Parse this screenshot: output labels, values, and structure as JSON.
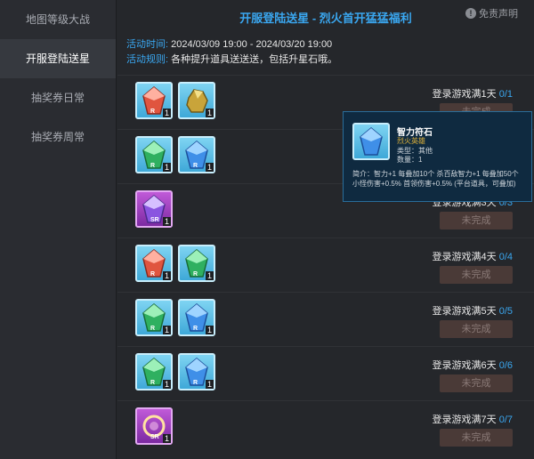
{
  "sidebar": {
    "items": [
      {
        "label": "地图等级大战",
        "active": false
      },
      {
        "label": "开服登陆送星",
        "active": true
      },
      {
        "label": "抽奖券日常",
        "active": false
      },
      {
        "label": "抽奖券周常",
        "active": false
      }
    ]
  },
  "header": {
    "title": "开服登陆送星 - 烈火首开猛猛福利",
    "disclaimer": "免责声明"
  },
  "info": {
    "time_label": "活动时间:",
    "time_value": "2024/03/09 19:00 - 2024/03/20 19:00",
    "rule_label": "活动规则:",
    "rule_value": "各种提升道具送送送，包括升星石哦。"
  },
  "rows": [
    {
      "goal": "登录游戏满1天",
      "progress": "0",
      "total": "/1",
      "status": "未完成",
      "items": [
        {
          "icon": "red-crystal-icon",
          "rarity": "R",
          "count": "1"
        },
        {
          "icon": "gold-ore-icon",
          "rarity": "",
          "count": "1"
        }
      ]
    },
    {
      "goal": "登录游戏满2天",
      "progress": "0",
      "total": "/2",
      "status": "未完成",
      "items": [
        {
          "icon": "green-crystal-icon",
          "rarity": "R",
          "count": "1"
        },
        {
          "icon": "blue-crystal-icon",
          "rarity": "R",
          "count": "1"
        }
      ]
    },
    {
      "goal": "登录游戏满3天",
      "progress": "0",
      "total": "/3",
      "status": "未完成",
      "items": [
        {
          "icon": "purple-crystal-icon",
          "rarity": "SR",
          "count": "1"
        }
      ]
    },
    {
      "goal": "登录游戏满4天",
      "progress": "0",
      "total": "/4",
      "status": "未完成",
      "items": [
        {
          "icon": "red-crystal-icon",
          "rarity": "R",
          "count": "1"
        },
        {
          "icon": "green-crystal-icon",
          "rarity": "R",
          "count": "1"
        }
      ]
    },
    {
      "goal": "登录游戏满5天",
      "progress": "0",
      "total": "/5",
      "status": "未完成",
      "items": [
        {
          "icon": "green-crystal-icon",
          "rarity": "R",
          "count": "1"
        },
        {
          "icon": "blue-crystal-icon",
          "rarity": "R",
          "count": "1"
        }
      ]
    },
    {
      "goal": "登录游戏满6天",
      "progress": "0",
      "total": "/6",
      "status": "未完成",
      "items": [
        {
          "icon": "green-crystal-icon",
          "rarity": "R",
          "count": "1"
        },
        {
          "icon": "blue-crystal-icon",
          "rarity": "R",
          "count": "1"
        }
      ]
    },
    {
      "goal": "登录游戏满7天",
      "progress": "0",
      "total": "/7",
      "status": "未完成",
      "items": [
        {
          "icon": "purple-swirl-icon",
          "rarity": "SR",
          "count": "1"
        }
      ]
    }
  ],
  "tooltip": {
    "name": "智力符石",
    "source": "烈火英雄",
    "type": "类型：其他",
    "qty": "数量：1",
    "desc": "简介：智力+1 每叠加10个 杀百敌智力+1 每叠加50个 小怪伤害+0.5% 首领伤害+0.5% (平台道具，可叠加)"
  },
  "colors": {
    "accent": "#3aa7f0",
    "status_bg": "#4a3a37",
    "tooltip_bg": "#0f2a40"
  }
}
